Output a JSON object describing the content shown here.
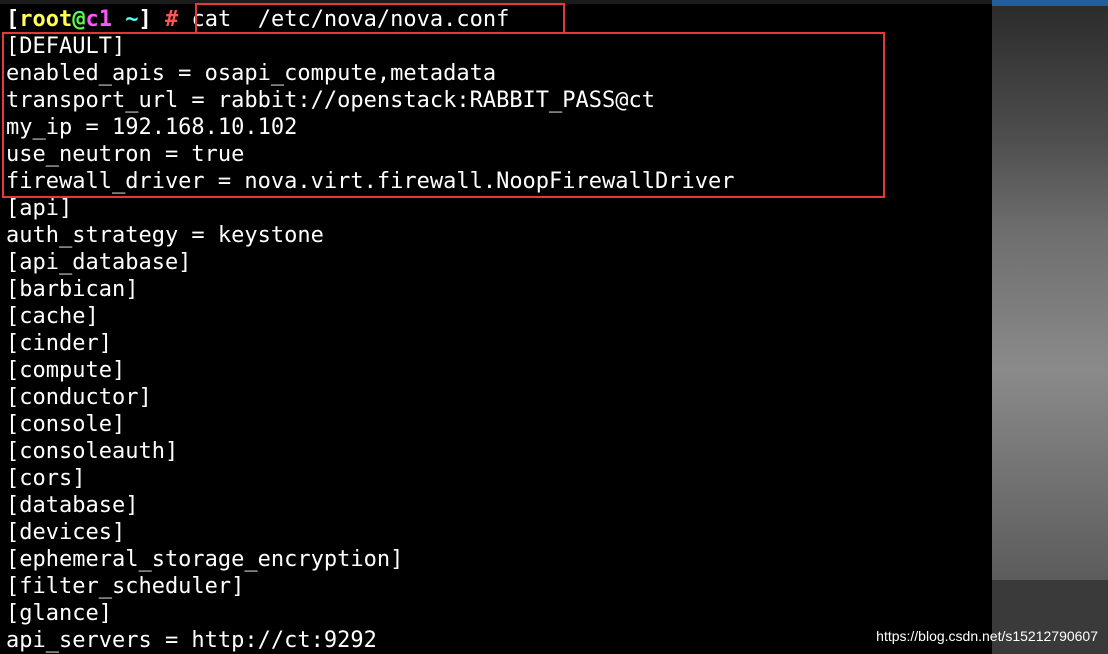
{
  "prompt": {
    "open_bracket": "[",
    "user": "root",
    "at": "@",
    "host": "c1",
    "dir": " ~",
    "close_bracket": "]",
    "symbol": " #",
    "command": "cat  /etc/nova/nova.conf"
  },
  "lines": [
    "[DEFAULT]",
    "enabled_apis = osapi_compute,metadata",
    "transport_url = rabbit://openstack:RABBIT_PASS@ct",
    "my_ip = 192.168.10.102",
    "use_neutron = true",
    "firewall_driver = nova.virt.firewall.NoopFirewallDriver",
    "[api]",
    "auth_strategy = keystone",
    "[api_database]",
    "[barbican]",
    "[cache]",
    "[cinder]",
    "[compute]",
    "[conductor]",
    "[console]",
    "[consoleauth]",
    "[cors]",
    "[database]",
    "[devices]",
    "[ephemeral_storage_encryption]",
    "[filter_scheduler]",
    "[glance]",
    "api_servers = http://ct:9292"
  ],
  "watermark": "https://blog.csdn.net/s15212790607",
  "colors": {
    "highlight": "#e53935",
    "background": "#000000",
    "text": "#ffffff"
  }
}
